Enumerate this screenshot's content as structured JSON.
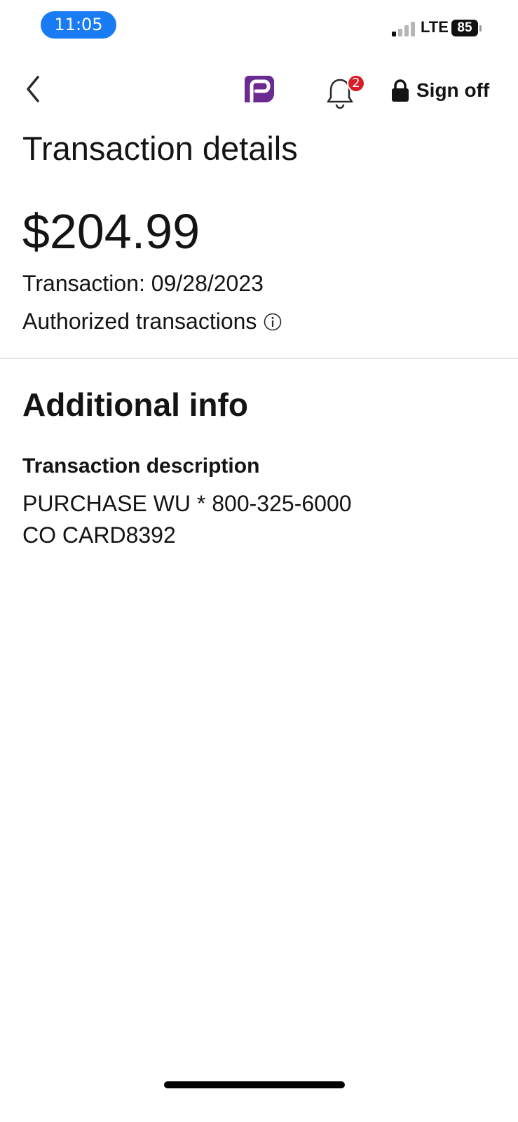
{
  "status_bar": {
    "time": "11:05",
    "network": "LTE",
    "battery": "85"
  },
  "nav": {
    "notification_count": "2",
    "sign_off_label": "Sign off",
    "logo_color": "#6b2a8f"
  },
  "transaction": {
    "title": "Transaction details",
    "amount": "$204.99",
    "date_line": "Transaction: 09/28/2023",
    "status": "Authorized transactions"
  },
  "additional_info": {
    "title": "Additional info",
    "description_label": "Transaction description",
    "description_line_1": "PURCHASE WU * 800-325-6000",
    "description_line_2": "CO CARD8392"
  },
  "colors": {
    "accent_blue": "#1a7cf5",
    "badge_red": "#d71e28",
    "brand_purple": "#6b2a8f"
  }
}
